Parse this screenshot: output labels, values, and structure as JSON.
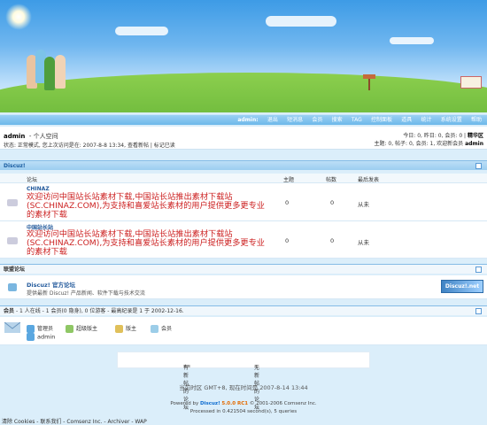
{
  "colors": {
    "sky": "#4aa3e8",
    "grass": "#7cc242",
    "nav_bg": "#7fc0ec",
    "link_blue": "#235a9c",
    "desc_red": "#cc2020",
    "page_bg": "#dbeefa"
  },
  "nav": {
    "user": "admin:",
    "items": [
      "退出",
      "短消息",
      "会员",
      "搜索",
      "TAG",
      "控制面板",
      "道具",
      "统计",
      "系统设置",
      "帮助"
    ]
  },
  "user_bar": {
    "username": "admin",
    "space_link": "- 个人空间",
    "status_prefix": "状态: 正常模式, 您上次访问是在: 2007-8-8 13:34,",
    "new_posts_link": "查看新帖",
    "mark_read": "| 标记已读",
    "today_stats": "今日: 0, 昨日: 0, 会员: 0 |",
    "digest_link": "精华区",
    "totals": "主题: 0, 帖子: 0, 会员: 1, 欢迎新会员",
    "newest_member": "admin"
  },
  "category": {
    "title": "Discuz!",
    "columns": {
      "forum": "论坛",
      "topics": "主题",
      "posts": "帖数",
      "last_post": "最后发表"
    },
    "forums": [
      {
        "name": "CHINAZ",
        "description": "欢迎访问中国站长站素材下载,中国站长站推出素材下载站(SC.CHINAZ.COM),为支持和喜爱站长素材的用户提供更多更专业的素材下载",
        "topics": "0",
        "posts": "0",
        "last_post": "从未"
      },
      {
        "name": "中国站长站",
        "description": "欢迎访问中国站长站素材下载,中国站长站推出素材下载站(SC.CHINAZ.COM),为支持和喜爱站长素材的用户提供更多更专业的素材下载",
        "topics": "0",
        "posts": "0",
        "last_post": "从未"
      }
    ]
  },
  "partners": {
    "title": "联盟论坛",
    "name": "Discuz! 官方论坛",
    "description": "提供最新 Discuz! 产品新闻、软件下载与技术交流",
    "logo_text": "Discuz!.net"
  },
  "online": {
    "title": "会员",
    "summary": "- 1 人在线 - 1 会员(0 隐身), 0 位游客 - 最高纪录是 1 于 2002-12-16.",
    "legend": [
      "管理员",
      "超级版主",
      "版主",
      "会员"
    ],
    "users": [
      "admin"
    ]
  },
  "forum_legend": {
    "new": "有新帖的论坛",
    "none": "无新帖的论坛"
  },
  "footer": {
    "timezone": "当前时区 GMT+8, 现在时间是 2007-8-14 13:44",
    "powered_prefix": "Powered by",
    "brand": "Discuz!",
    "version": "5.0.0 RC1",
    "copyright": "© 2001-2006 Comsenz Inc.",
    "processed": "Processed in 0.421504 second(s), 5 queries",
    "links": "清除 Cookies - 联系我们 - Comsenz Inc. - Archiver - WAP"
  }
}
